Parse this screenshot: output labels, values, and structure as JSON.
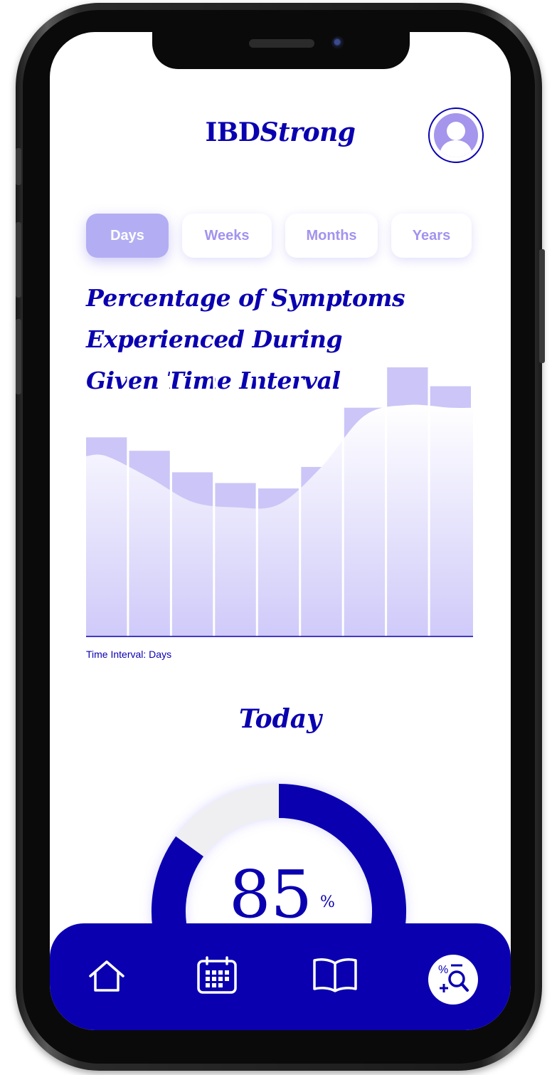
{
  "app": {
    "title_plain": "IBD",
    "title_italic": "Strong"
  },
  "avatar": {
    "icon": "user-avatar-icon"
  },
  "time_tabs": [
    {
      "label": "Days",
      "active": true
    },
    {
      "label": "Weeks",
      "active": false
    },
    {
      "label": "Months",
      "active": false
    },
    {
      "label": "Years",
      "active": false
    }
  ],
  "chart": {
    "title_line1": "Percentage of Symptoms",
    "title_line2": "Experienced During",
    "title_line3": "Given Time Interval",
    "x_caption": "Time Interval: Days"
  },
  "chart_data": {
    "type": "bar",
    "title": "Percentage of Symptoms Experienced During Given Time Interval",
    "xlabel": "Time Interval: Days",
    "ylabel": "",
    "categories": [
      "",
      "",
      "",
      "",
      "",
      "",
      "",
      "",
      ""
    ],
    "values": [
      74,
      69,
      61,
      57,
      55,
      63,
      85,
      100,
      93
    ],
    "curve_values": [
      67,
      59,
      50,
      48,
      49,
      63,
      82,
      86,
      85
    ],
    "ylim": [
      0,
      100
    ],
    "grid": false
  },
  "today": {
    "heading": "Today",
    "value": "85",
    "unit": "%",
    "gauge_fraction": 0.85
  },
  "nav": {
    "items": [
      {
        "name": "home",
        "icon": "home-icon"
      },
      {
        "name": "calendar",
        "icon": "calendar-icon"
      },
      {
        "name": "journal",
        "icon": "book-icon"
      },
      {
        "name": "symptom-analysis",
        "icon": "percent-search-icon",
        "active": true
      }
    ]
  },
  "colors": {
    "primary": "#0a00b0",
    "accent_light": "#b3aef3",
    "bar_fill": "#cbc6f7",
    "track": "#f0f0f0"
  }
}
